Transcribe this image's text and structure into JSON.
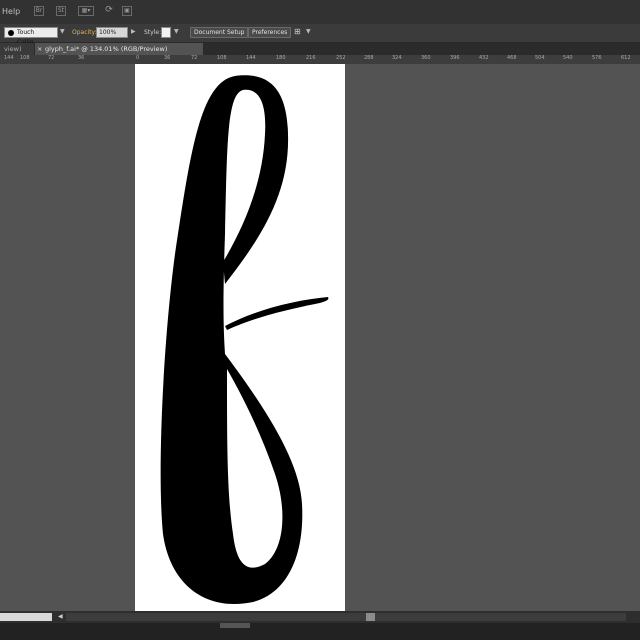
{
  "menu": {
    "help_label": "Help",
    "icons": [
      "bridge-icon",
      "stock-icon",
      "arrange-documents-icon",
      "gpu-icon",
      "sync-settings-icon"
    ]
  },
  "control_bar": {
    "brush_name": "Touch Callig...",
    "opacity_label": "Opacity:",
    "opacity_value": "100%",
    "style_label": "Style:",
    "document_setup": "Document Setup",
    "preferences": "Preferences"
  },
  "tabs": {
    "previous": "view)",
    "active": "glyph_f.ai* @ 134.01% (RGB/Preview)"
  },
  "ruler": {
    "labels": [
      "144",
      "108",
      "72",
      "36",
      "0",
      "36",
      "72",
      "108",
      "144",
      "180",
      "216",
      "252",
      "288",
      "324",
      "360",
      "396",
      "432",
      "468",
      "504",
      "540",
      "576",
      "612"
    ]
  },
  "colors": {
    "ui_dark": "#323232",
    "canvas": "#535353",
    "artboard": "#ffffff",
    "glyph": "#000000",
    "opacity_label": "#e8b04a"
  }
}
